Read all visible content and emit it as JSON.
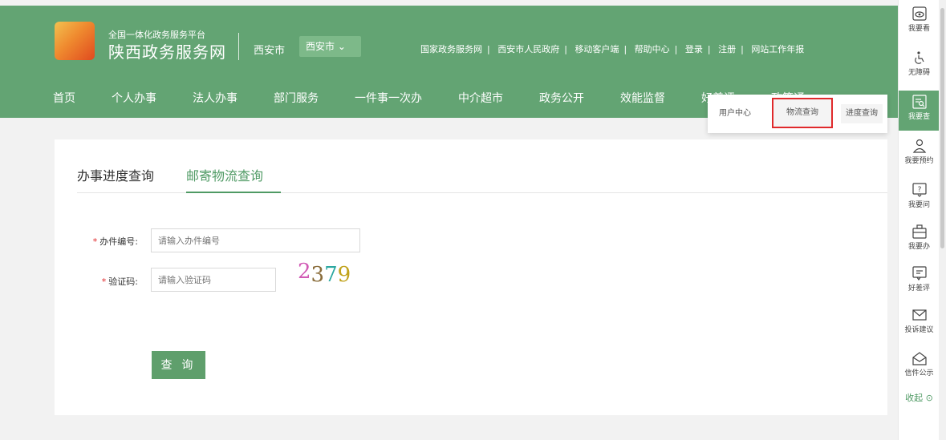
{
  "brand": {
    "subtitle": "全国一体化政务服务平台",
    "title": "陕西政务服务网"
  },
  "city": {
    "label": "西安市",
    "select": "西安市 ⌄"
  },
  "top_links": [
    "国家政务服务网",
    "西安市人民政府",
    "移动客户端",
    "帮助中心",
    "登录",
    "注册",
    "网站工作年报"
  ],
  "nav": [
    "首页",
    "个人办事",
    "法人办事",
    "部门服务",
    "一件事一次办",
    "中介超市",
    "政务公开",
    "效能监督",
    "好差评",
    "政策通"
  ],
  "dropdown": {
    "items": [
      "用户中心",
      "物流查询",
      "进度查询"
    ]
  },
  "tabs": [
    "办事进度查询",
    "邮寄物流查询"
  ],
  "form": {
    "case_label": "办件编号:",
    "case_placeholder": "请输入办件编号",
    "captcha_label": "验证码:",
    "captcha_placeholder": "请输入验证码",
    "required_mark": "*",
    "captcha_chars": [
      "2",
      "3",
      "7",
      "9"
    ],
    "submit": "查 询"
  },
  "sidebar": {
    "items": [
      {
        "label": "我要看",
        "icon": "eye-icon"
      },
      {
        "label": "无障碍",
        "icon": "accessibility-icon"
      },
      {
        "label": "我要查",
        "icon": "search-doc-icon"
      },
      {
        "label": "我要预约",
        "icon": "person-icon"
      },
      {
        "label": "我要问",
        "icon": "question-icon"
      },
      {
        "label": "我要办",
        "icon": "briefcase-icon"
      },
      {
        "label": "好差评",
        "icon": "comment-icon"
      },
      {
        "label": "投诉建议",
        "icon": "mail-icon"
      },
      {
        "label": "信件公示",
        "icon": "open-mail-icon"
      }
    ],
    "collapse": "收起 ⊙"
  },
  "colors": {
    "primary": "#63a473",
    "accent": "#4f9a64",
    "highlight": "#e0292b"
  }
}
